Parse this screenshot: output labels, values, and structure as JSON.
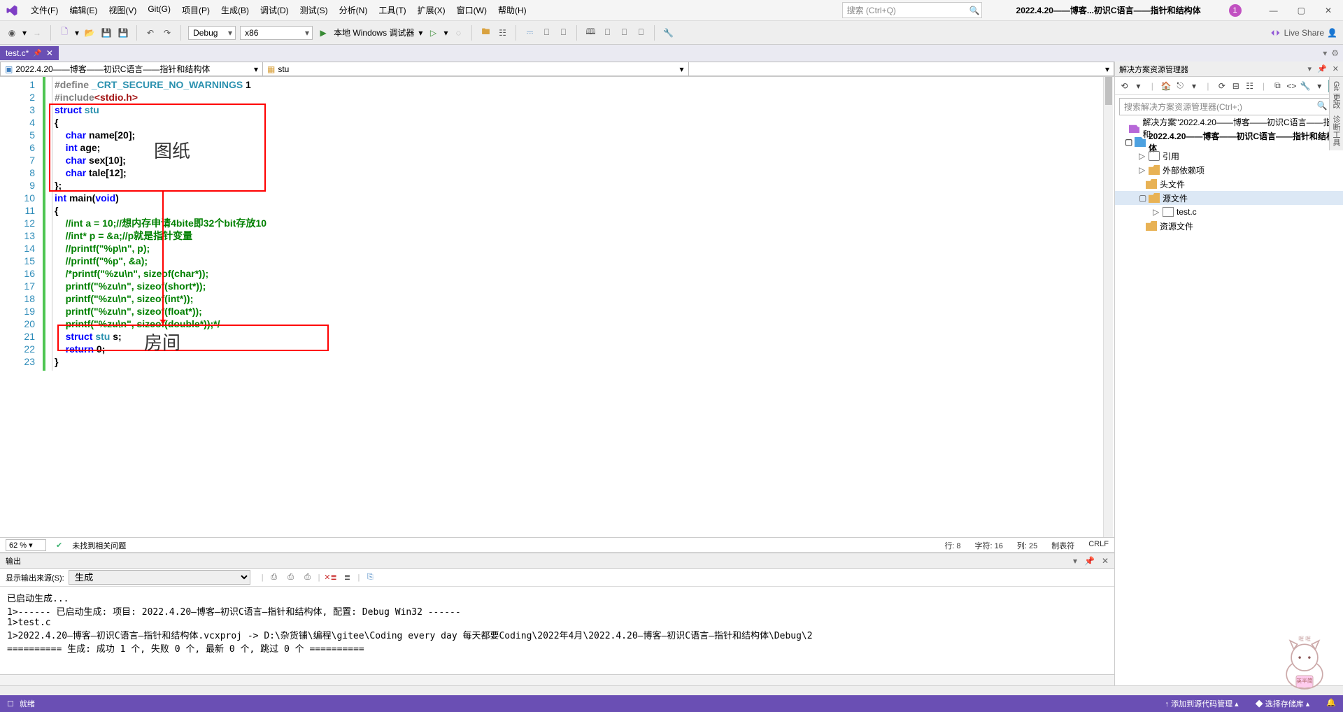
{
  "title": "2022.4.20——博客...初识C语言——指针和结构体",
  "badge": "1",
  "menu": [
    "文件(F)",
    "编辑(E)",
    "视图(V)",
    "Git(G)",
    "项目(P)",
    "生成(B)",
    "调试(D)",
    "测试(S)",
    "分析(N)",
    "工具(T)",
    "扩展(X)",
    "窗口(W)",
    "帮助(H)"
  ],
  "search_placeholder": "搜索 (Ctrl+Q)",
  "toolbar": {
    "config": "Debug",
    "platform": "x86",
    "debug_label": "本地 Windows 调试器",
    "liveshare": "Live Share"
  },
  "tab": {
    "label": "test.c*"
  },
  "nav": {
    "left": "2022.4.20——博客——初识C语言——指针和结构体",
    "right": "stu"
  },
  "status": {
    "zoom": "62 %",
    "issues": "未找到相关问题",
    "line": "行: 8",
    "char": "字符: 16",
    "col": "列: 25",
    "tabs": "制表符",
    "eol": "CRLF"
  },
  "annot": {
    "a1": "图纸",
    "a2": "房间"
  },
  "code": [
    {
      "n": 1,
      "segs": [
        {
          "c": "pp",
          "t": "#define "
        },
        {
          "c": "ty",
          "t": "_CRT_SECURE_NO_WARNINGS"
        },
        {
          "c": "nm",
          "t": " 1"
        }
      ]
    },
    {
      "n": 2,
      "segs": [
        {
          "c": "pp",
          "t": "#include"
        },
        {
          "c": "inc",
          "t": "<stdio.h>"
        }
      ]
    },
    {
      "n": 3,
      "segs": [
        {
          "c": "kw",
          "t": "struct "
        },
        {
          "c": "ty",
          "t": "stu"
        }
      ]
    },
    {
      "n": 4,
      "segs": [
        {
          "c": "nm",
          "t": "{"
        }
      ]
    },
    {
      "n": 5,
      "segs": [
        {
          "c": "nm",
          "t": "    "
        },
        {
          "c": "kw",
          "t": "char"
        },
        {
          "c": "nm",
          "t": " name[20];"
        }
      ]
    },
    {
      "n": 6,
      "segs": [
        {
          "c": "nm",
          "t": "    "
        },
        {
          "c": "kw",
          "t": "int"
        },
        {
          "c": "nm",
          "t": " age;"
        }
      ]
    },
    {
      "n": 7,
      "segs": [
        {
          "c": "nm",
          "t": "    "
        },
        {
          "c": "kw",
          "t": "char"
        },
        {
          "c": "nm",
          "t": " sex[10];"
        }
      ]
    },
    {
      "n": 8,
      "segs": [
        {
          "c": "nm",
          "t": "    "
        },
        {
          "c": "kw",
          "t": "char"
        },
        {
          "c": "nm",
          "t": " tale[12];"
        }
      ]
    },
    {
      "n": 9,
      "segs": [
        {
          "c": "nm",
          "t": "};"
        }
      ]
    },
    {
      "n": 10,
      "segs": [
        {
          "c": "kw",
          "t": "int"
        },
        {
          "c": "nm",
          "t": " main("
        },
        {
          "c": "kw",
          "t": "void"
        },
        {
          "c": "nm",
          "t": ")"
        }
      ]
    },
    {
      "n": 11,
      "segs": [
        {
          "c": "nm",
          "t": "{"
        }
      ]
    },
    {
      "n": 12,
      "segs": [
        {
          "c": "nm",
          "t": "    "
        },
        {
          "c": "cm",
          "t": "//int a = 10;//想内存申请4bite即32个bit存放10"
        }
      ]
    },
    {
      "n": 13,
      "segs": [
        {
          "c": "nm",
          "t": "    "
        },
        {
          "c": "cm",
          "t": "//int* p = &a;//p就是指针变量"
        }
      ]
    },
    {
      "n": 14,
      "segs": [
        {
          "c": "nm",
          "t": "    "
        },
        {
          "c": "cm",
          "t": "//printf(\"%p\\n\", p);"
        }
      ]
    },
    {
      "n": 15,
      "segs": [
        {
          "c": "nm",
          "t": "    "
        },
        {
          "c": "cm",
          "t": "//printf(\"%p\", &a);"
        }
      ]
    },
    {
      "n": 16,
      "segs": [
        {
          "c": "nm",
          "t": "    "
        },
        {
          "c": "cm",
          "t": "/*printf(\"%zu\\n\", sizeof(char*));"
        }
      ]
    },
    {
      "n": 17,
      "segs": [
        {
          "c": "nm",
          "t": "    "
        },
        {
          "c": "cm",
          "t": "printf(\"%zu\\n\", sizeof(short*));"
        }
      ]
    },
    {
      "n": 18,
      "segs": [
        {
          "c": "nm",
          "t": "    "
        },
        {
          "c": "cm",
          "t": "printf(\"%zu\\n\", sizeof(int*));"
        }
      ]
    },
    {
      "n": 19,
      "segs": [
        {
          "c": "nm",
          "t": "    "
        },
        {
          "c": "cm",
          "t": "printf(\"%zu\\n\", sizeof(float*));"
        }
      ]
    },
    {
      "n": 20,
      "segs": [
        {
          "c": "nm",
          "t": "    "
        },
        {
          "c": "cm",
          "t": "printf(\"%zu\\n\", sizeof(double*));*/"
        }
      ]
    },
    {
      "n": 21,
      "segs": [
        {
          "c": "nm",
          "t": "    "
        },
        {
          "c": "kw",
          "t": "struct "
        },
        {
          "c": "ty",
          "t": "stu"
        },
        {
          "c": "nm",
          "t": " s;"
        }
      ]
    },
    {
      "n": 22,
      "segs": [
        {
          "c": "nm",
          "t": "    "
        },
        {
          "c": "kw",
          "t": "return"
        },
        {
          "c": "nm",
          "t": " 0;"
        }
      ]
    },
    {
      "n": 23,
      "segs": [
        {
          "c": "nm",
          "t": "}"
        }
      ]
    }
  ],
  "output": {
    "title": "输出",
    "from_label": "显示输出来源(S):",
    "from_value": "生成",
    "body": "已启动生成...\n1>------ 已启动生成: 项目: 2022.4.20—博客—初识C语言—指针和结构体, 配置: Debug Win32 ------\n1>test.c\n1>2022.4.20—博客—初识C语言—指针和结构体.vcxproj -> D:\\杂货铺\\编程\\gitee\\Coding every day 每天都要Coding\\2022年4月\\2022.4.20—博客—初识C语言—指针和结构体\\Debug\\2\n========== 生成: 成功 1 个, 失败 0 个, 最新 0 个, 跳过 0 个 =========="
  },
  "solution": {
    "title": "解决方案资源管理器",
    "search": "搜索解决方案资源管理器(Ctrl+;)",
    "root": "解决方案\"2022.4.20——博客——初识C语言——指针和",
    "proj": "2022.4.20——博客——初识C语言——指针和结构体",
    "items": [
      "引用",
      "外部依赖项",
      "头文件",
      "源文件",
      "test.c",
      "资源文件"
    ]
  },
  "rtabs": [
    "Git 更改",
    "诊断工具"
  ],
  "bottom": {
    "ready": "就绪",
    "src": "↑ 添加到源代码管理 ▴",
    "repo": "◆ 选择存储库 ▴",
    "bell": "🔔"
  }
}
